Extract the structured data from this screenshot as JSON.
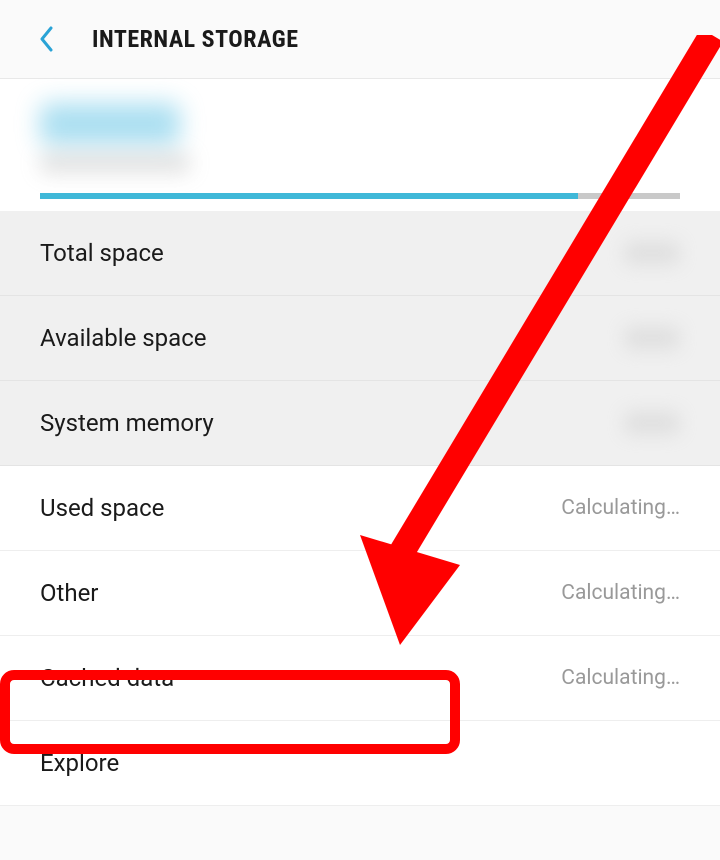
{
  "header": {
    "title": "INTERNAL STORAGE"
  },
  "items": [
    {
      "label": "Total space",
      "value": "",
      "blurred": true,
      "dim": true
    },
    {
      "label": "Available space",
      "value": "",
      "blurred": true,
      "dim": true
    },
    {
      "label": "System memory",
      "value": "",
      "blurred": true,
      "dim": true
    },
    {
      "label": "Used space",
      "value": "Calculating…",
      "blurred": false,
      "dim": false
    },
    {
      "label": "Other",
      "value": "Calculating…",
      "blurred": false,
      "dim": false
    },
    {
      "label": "Cached data",
      "value": "Calculating…",
      "blurred": false,
      "dim": false
    },
    {
      "label": "Explore",
      "value": "",
      "blurred": false,
      "dim": false
    }
  ],
  "colors": {
    "accent": "#3fb8d8",
    "annotation": "#f00"
  }
}
